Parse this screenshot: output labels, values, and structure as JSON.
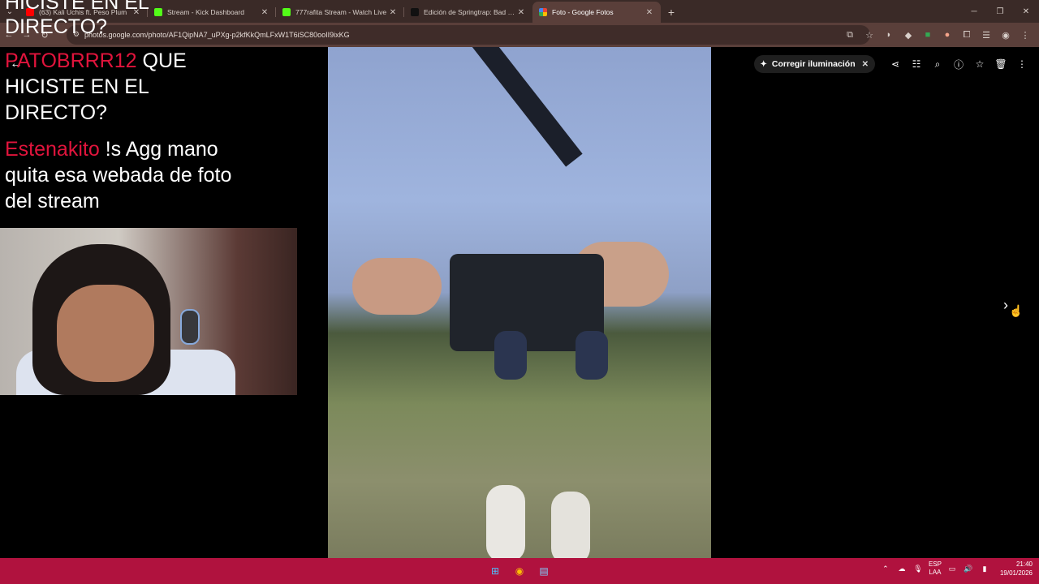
{
  "browser": {
    "tabs": [
      {
        "title": "(63) Kali Uchis ft. Peso Plum",
        "favicon_color": "#ff0000",
        "active": false
      },
      {
        "title": "Stream - Kick Dashboard",
        "favicon_color": "#53fc18",
        "active": false
      },
      {
        "title": "777rafita Stream - Watch Live",
        "favicon_color": "#53fc18",
        "active": false
      },
      {
        "title": "Edición de Springtrap: Bad Hap",
        "favicon_color": "#111111",
        "active": false
      },
      {
        "title": "Foto - Google Fotos",
        "favicon_color": "#fbbc04",
        "active": true
      }
    ],
    "new_tab": "+",
    "url": "photos.google.com/photo/AF1QipNA7_uPXg-p2kfKkQmLFxW1T6iSC80ooII9ixKG"
  },
  "overlay": {
    "top_text": "HICISTE EN EL DIRECTO?",
    "chat": [
      {
        "user": "PATOBRRR12",
        "message": "QUE HICISTE EN EL DIRECTO?"
      },
      {
        "user": "Estenakito",
        "message": "!s Agg mano quita esa webada de foto del stream"
      }
    ]
  },
  "photos": {
    "fix_lighting": "Corregir iluminación"
  },
  "taskbar": {
    "lang_top": "ESP",
    "lang_bottom": "LAA",
    "time": "21:40",
    "date": "19/01/2026"
  }
}
